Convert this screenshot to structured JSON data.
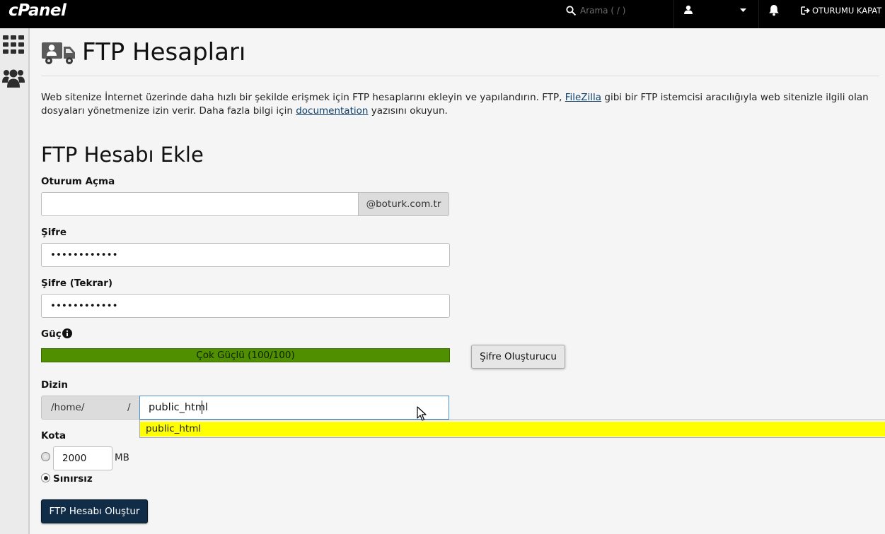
{
  "topbar": {
    "logo": "cPanel",
    "search_placeholder": "Arama ( / )",
    "logout_label": "OTURUMU KAPAT"
  },
  "sidebar": {
    "items": [
      {
        "icon": "apps-grid-icon"
      },
      {
        "icon": "users-icon"
      }
    ]
  },
  "page": {
    "title": "FTP Hesapları",
    "intro_part1": "Web sitenize İnternet üzerinde daha hızlı bir şekilde erişmek için FTP hesaplarını ekleyin ve yapılandırın. FTP, ",
    "intro_link1": "FileZilla",
    "intro_part2": " gibi bir FTP istemcisi aracılığıyla web sitenizle ilgili olan dosyaları yönetmenize izin verir. Daha fazla bilgi için ",
    "intro_link2": "documentation",
    "intro_part3": " yazısını okuyun."
  },
  "form": {
    "section_title": "FTP Hesabı Ekle",
    "login_label": "Oturum Açma",
    "login_value": "",
    "domain_suffix": "@boturk.com.tr",
    "password_label": "Şifre",
    "password_value": "••••••••••••",
    "password_confirm_label": "Şifre (Tekrar)",
    "password_confirm_value": "••••••••••••",
    "strength_label": "Güç",
    "strength_text": "Çok Güçlü (100/100)",
    "strength_value": 100,
    "generator_label": "Şifre Oluşturucu",
    "directory_label": "Dizin",
    "directory_prefix": "/home/",
    "directory_separator": "/",
    "directory_value": "public_html",
    "autocomplete_suggestion": "public_html",
    "quota_label": "Kota",
    "quota_value": "2000",
    "quota_unit": "MB",
    "unlimited_label": "Sınırsız",
    "submit_label": "FTP Hesabı Oluştur"
  },
  "colors": {
    "topbar": "#000000",
    "strength_fill": "#4f8f00",
    "autocomplete_highlight": "#ffff00",
    "primary_button": "#102c47",
    "link": "#0c3f6a"
  }
}
